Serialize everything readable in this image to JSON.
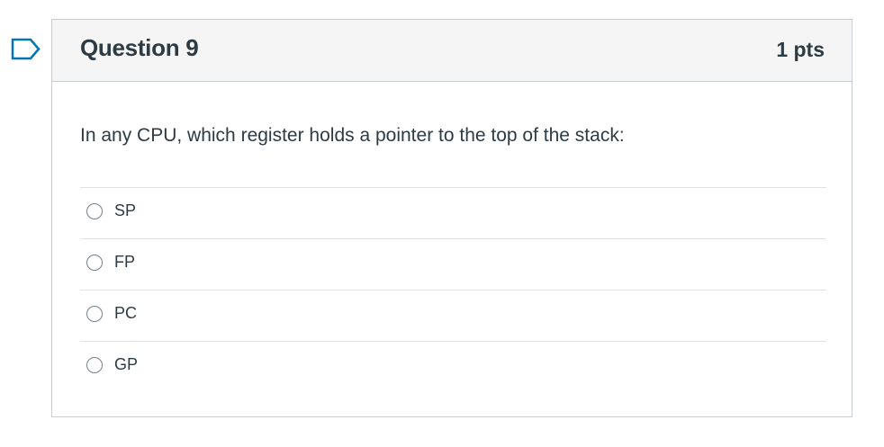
{
  "question": {
    "title": "Question 9",
    "points": "1 pts",
    "text": "In any CPU, which register holds a pointer to the top of the stack:",
    "flag_icon": "flag-icon",
    "answers": [
      {
        "label": "SP",
        "selected": false
      },
      {
        "label": "FP",
        "selected": false
      },
      {
        "label": "PC",
        "selected": false
      },
      {
        "label": "GP",
        "selected": false
      }
    ]
  },
  "colors": {
    "flag_blue": "#0374b5",
    "header_bg": "#f5f5f5",
    "border": "#c7cdd1",
    "text": "#2d3b45"
  }
}
